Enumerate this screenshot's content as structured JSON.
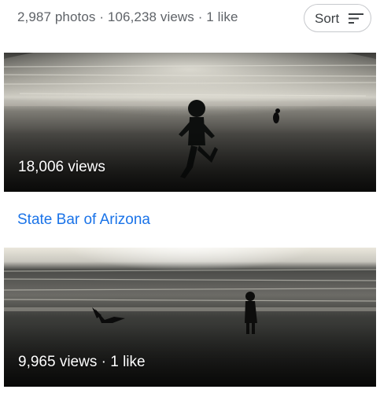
{
  "header": {
    "stats": "2,987 photos · 106,238 views · 1 like",
    "sort_label": "Sort",
    "sort_icon": "sort-lines-icon"
  },
  "photos": [
    {
      "caption": "18,006 views",
      "description_icon": "beach-photo"
    },
    {
      "caption": "9,965 views · 1 like",
      "description_icon": "beach-photo"
    }
  ],
  "sections": [
    {
      "title": "State Bar of Arizona"
    }
  ],
  "colors": {
    "link": "#1a73e8",
    "muted_text": "#5f6368"
  }
}
